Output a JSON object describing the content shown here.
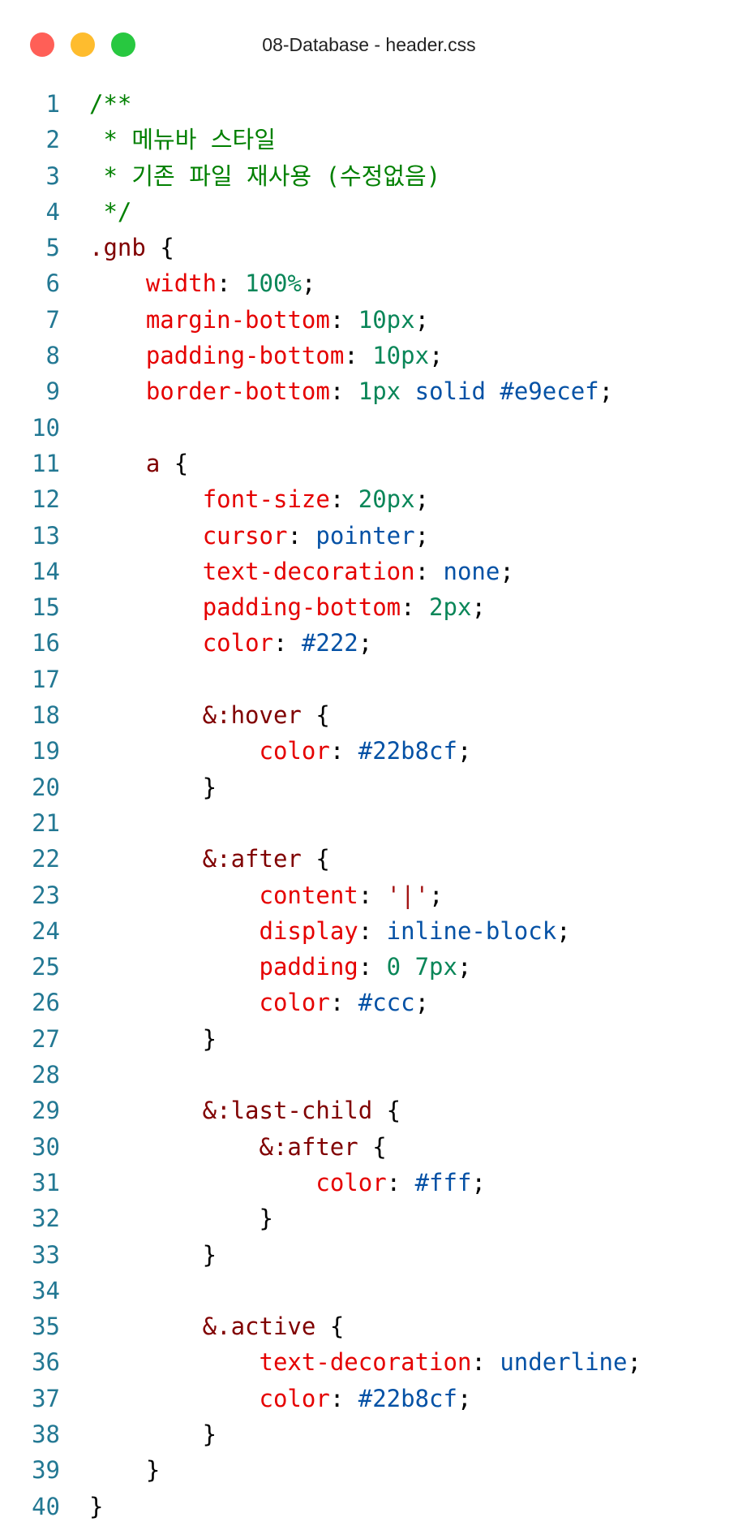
{
  "window": {
    "title": "08-Database - header.css"
  },
  "colors": {
    "line_number": "#237893",
    "comment": "#008000",
    "selector": "#800000",
    "property": "#e50000",
    "number": "#098658",
    "keyword": "#0451a5",
    "string": "#a31515",
    "punctuation": "#000000",
    "close_button": "#ff5f57",
    "minimize_button": "#febc2e",
    "maximize_button": "#28c840"
  },
  "lines": [
    {
      "n": "1",
      "tokens": [
        {
          "t": "/**",
          "c": "cm"
        }
      ]
    },
    {
      "n": "2",
      "tokens": [
        {
          "t": " * 메뉴바 스타일",
          "c": "cm"
        }
      ]
    },
    {
      "n": "3",
      "tokens": [
        {
          "t": " * 기존 파일 재사용 (수정없음)",
          "c": "cm"
        }
      ]
    },
    {
      "n": "4",
      "tokens": [
        {
          "t": " */",
          "c": "cm"
        }
      ]
    },
    {
      "n": "5",
      "tokens": [
        {
          "t": ".gnb ",
          "c": "sel"
        },
        {
          "t": "{",
          "c": "pn"
        }
      ]
    },
    {
      "n": "6",
      "tokens": [
        {
          "t": "    ",
          "c": "pn"
        },
        {
          "t": "width",
          "c": "prop"
        },
        {
          "t": ": ",
          "c": "pn"
        },
        {
          "t": "100%",
          "c": "num"
        },
        {
          "t": ";",
          "c": "pn"
        }
      ]
    },
    {
      "n": "7",
      "tokens": [
        {
          "t": "    ",
          "c": "pn"
        },
        {
          "t": "margin-bottom",
          "c": "prop"
        },
        {
          "t": ": ",
          "c": "pn"
        },
        {
          "t": "10px",
          "c": "num"
        },
        {
          "t": ";",
          "c": "pn"
        }
      ]
    },
    {
      "n": "8",
      "tokens": [
        {
          "t": "    ",
          "c": "pn"
        },
        {
          "t": "padding-bottom",
          "c": "prop"
        },
        {
          "t": ": ",
          "c": "pn"
        },
        {
          "t": "10px",
          "c": "num"
        },
        {
          "t": ";",
          "c": "pn"
        }
      ]
    },
    {
      "n": "9",
      "tokens": [
        {
          "t": "    ",
          "c": "pn"
        },
        {
          "t": "border-bottom",
          "c": "prop"
        },
        {
          "t": ": ",
          "c": "pn"
        },
        {
          "t": "1px",
          "c": "num"
        },
        {
          "t": " ",
          "c": "pn"
        },
        {
          "t": "solid",
          "c": "kw"
        },
        {
          "t": " ",
          "c": "pn"
        },
        {
          "t": "#e9ecef",
          "c": "kw"
        },
        {
          "t": ";",
          "c": "pn"
        }
      ]
    },
    {
      "n": "10",
      "tokens": []
    },
    {
      "n": "11",
      "tokens": [
        {
          "t": "    a ",
          "c": "sel"
        },
        {
          "t": "{",
          "c": "pn"
        }
      ]
    },
    {
      "n": "12",
      "tokens": [
        {
          "t": "        ",
          "c": "pn"
        },
        {
          "t": "font-size",
          "c": "prop"
        },
        {
          "t": ": ",
          "c": "pn"
        },
        {
          "t": "20px",
          "c": "num"
        },
        {
          "t": ";",
          "c": "pn"
        }
      ]
    },
    {
      "n": "13",
      "tokens": [
        {
          "t": "        ",
          "c": "pn"
        },
        {
          "t": "cursor",
          "c": "prop"
        },
        {
          "t": ": ",
          "c": "pn"
        },
        {
          "t": "pointer",
          "c": "kw"
        },
        {
          "t": ";",
          "c": "pn"
        }
      ]
    },
    {
      "n": "14",
      "tokens": [
        {
          "t": "        ",
          "c": "pn"
        },
        {
          "t": "text-decoration",
          "c": "prop"
        },
        {
          "t": ": ",
          "c": "pn"
        },
        {
          "t": "none",
          "c": "kw"
        },
        {
          "t": ";",
          "c": "pn"
        }
      ]
    },
    {
      "n": "15",
      "tokens": [
        {
          "t": "        ",
          "c": "pn"
        },
        {
          "t": "padding-bottom",
          "c": "prop"
        },
        {
          "t": ": ",
          "c": "pn"
        },
        {
          "t": "2px",
          "c": "num"
        },
        {
          "t": ";",
          "c": "pn"
        }
      ]
    },
    {
      "n": "16",
      "tokens": [
        {
          "t": "        ",
          "c": "pn"
        },
        {
          "t": "color",
          "c": "prop"
        },
        {
          "t": ": ",
          "c": "pn"
        },
        {
          "t": "#222",
          "c": "kw"
        },
        {
          "t": ";",
          "c": "pn"
        }
      ]
    },
    {
      "n": "17",
      "tokens": []
    },
    {
      "n": "18",
      "tokens": [
        {
          "t": "        &:hover ",
          "c": "sel"
        },
        {
          "t": "{",
          "c": "pn"
        }
      ]
    },
    {
      "n": "19",
      "tokens": [
        {
          "t": "            ",
          "c": "pn"
        },
        {
          "t": "color",
          "c": "prop"
        },
        {
          "t": ": ",
          "c": "pn"
        },
        {
          "t": "#22b8cf",
          "c": "kw"
        },
        {
          "t": ";",
          "c": "pn"
        }
      ]
    },
    {
      "n": "20",
      "tokens": [
        {
          "t": "        }",
          "c": "pn"
        }
      ]
    },
    {
      "n": "21",
      "tokens": []
    },
    {
      "n": "22",
      "tokens": [
        {
          "t": "        &:after ",
          "c": "sel"
        },
        {
          "t": "{",
          "c": "pn"
        }
      ]
    },
    {
      "n": "23",
      "tokens": [
        {
          "t": "            ",
          "c": "pn"
        },
        {
          "t": "content",
          "c": "prop"
        },
        {
          "t": ": ",
          "c": "pn"
        },
        {
          "t": "'|'",
          "c": "str"
        },
        {
          "t": ";",
          "c": "pn"
        }
      ]
    },
    {
      "n": "24",
      "tokens": [
        {
          "t": "            ",
          "c": "pn"
        },
        {
          "t": "display",
          "c": "prop"
        },
        {
          "t": ": ",
          "c": "pn"
        },
        {
          "t": "inline-block",
          "c": "kw"
        },
        {
          "t": ";",
          "c": "pn"
        }
      ]
    },
    {
      "n": "25",
      "tokens": [
        {
          "t": "            ",
          "c": "pn"
        },
        {
          "t": "padding",
          "c": "prop"
        },
        {
          "t": ": ",
          "c": "pn"
        },
        {
          "t": "0 7px",
          "c": "num"
        },
        {
          "t": ";",
          "c": "pn"
        }
      ]
    },
    {
      "n": "26",
      "tokens": [
        {
          "t": "            ",
          "c": "pn"
        },
        {
          "t": "color",
          "c": "prop"
        },
        {
          "t": ": ",
          "c": "pn"
        },
        {
          "t": "#ccc",
          "c": "kw"
        },
        {
          "t": ";",
          "c": "pn"
        }
      ]
    },
    {
      "n": "27",
      "tokens": [
        {
          "t": "        }",
          "c": "pn"
        }
      ]
    },
    {
      "n": "28",
      "tokens": []
    },
    {
      "n": "29",
      "tokens": [
        {
          "t": "        &:last-child ",
          "c": "sel"
        },
        {
          "t": "{",
          "c": "pn"
        }
      ]
    },
    {
      "n": "30",
      "tokens": [
        {
          "t": "            &:after ",
          "c": "sel"
        },
        {
          "t": "{",
          "c": "pn"
        }
      ]
    },
    {
      "n": "31",
      "tokens": [
        {
          "t": "                ",
          "c": "pn"
        },
        {
          "t": "color",
          "c": "prop"
        },
        {
          "t": ": ",
          "c": "pn"
        },
        {
          "t": "#fff",
          "c": "kw"
        },
        {
          "t": ";",
          "c": "pn"
        }
      ]
    },
    {
      "n": "32",
      "tokens": [
        {
          "t": "            }",
          "c": "pn"
        }
      ]
    },
    {
      "n": "33",
      "tokens": [
        {
          "t": "        }",
          "c": "pn"
        }
      ]
    },
    {
      "n": "34",
      "tokens": []
    },
    {
      "n": "35",
      "tokens": [
        {
          "t": "        &.active ",
          "c": "sel"
        },
        {
          "t": "{",
          "c": "pn"
        }
      ]
    },
    {
      "n": "36",
      "tokens": [
        {
          "t": "            ",
          "c": "pn"
        },
        {
          "t": "text-decoration",
          "c": "prop"
        },
        {
          "t": ": ",
          "c": "pn"
        },
        {
          "t": "underline",
          "c": "kw"
        },
        {
          "t": ";",
          "c": "pn"
        }
      ]
    },
    {
      "n": "37",
      "tokens": [
        {
          "t": "            ",
          "c": "pn"
        },
        {
          "t": "color",
          "c": "prop"
        },
        {
          "t": ": ",
          "c": "pn"
        },
        {
          "t": "#22b8cf",
          "c": "kw"
        },
        {
          "t": ";",
          "c": "pn"
        }
      ]
    },
    {
      "n": "38",
      "tokens": [
        {
          "t": "        }",
          "c": "pn"
        }
      ]
    },
    {
      "n": "39",
      "tokens": [
        {
          "t": "    }",
          "c": "pn"
        }
      ]
    },
    {
      "n": "40",
      "tokens": [
        {
          "t": "}",
          "c": "pn"
        }
      ]
    }
  ]
}
